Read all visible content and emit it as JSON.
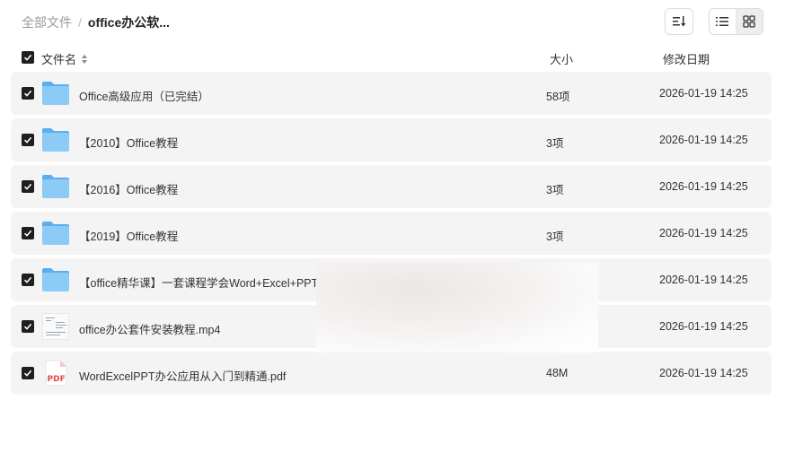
{
  "breadcrumb": {
    "root": "全部文件",
    "separator": "/",
    "current": "office办公软..."
  },
  "toolbar": {
    "sort_icon": "sort-lines-icon",
    "view_list_icon": "list-view-icon",
    "view_grid_icon": "grid-view-icon",
    "active_view": "grid"
  },
  "table": {
    "headers": {
      "name": "文件名",
      "size": "大小",
      "date": "修改日期"
    },
    "rows": [
      {
        "type": "folder",
        "name": "Office高级应用（已完结）",
        "size": "58项",
        "date": "2026-01-19 14:25"
      },
      {
        "type": "folder",
        "name": "【2010】Office教程",
        "size": "3项",
        "date": "2026-01-19 14:25"
      },
      {
        "type": "folder",
        "name": "【2016】Office教程",
        "size": "3项",
        "date": "2026-01-19 14:25"
      },
      {
        "type": "folder",
        "name": "【2019】Office教程",
        "size": "3项",
        "date": "2026-01-19 14:25"
      },
      {
        "type": "folder",
        "name": "【office精华课】一套课程学会Word+Excel+PPT",
        "size": "",
        "date": "2026-01-19 14:25"
      },
      {
        "type": "video",
        "name": "office办公套件安装教程.mp4",
        "size": "",
        "date": "2026-01-19 14:25"
      },
      {
        "type": "pdf",
        "name": "WordExcelPPT办公应用从入门到精通.pdf",
        "size": "48M",
        "date": "2026-01-19 14:25"
      }
    ]
  },
  "colors": {
    "row_bg": "#f4f4f5",
    "checkbox": "#1f1f1f",
    "folder": "#7cc0f5",
    "pdf_red": "#e04b4b"
  }
}
